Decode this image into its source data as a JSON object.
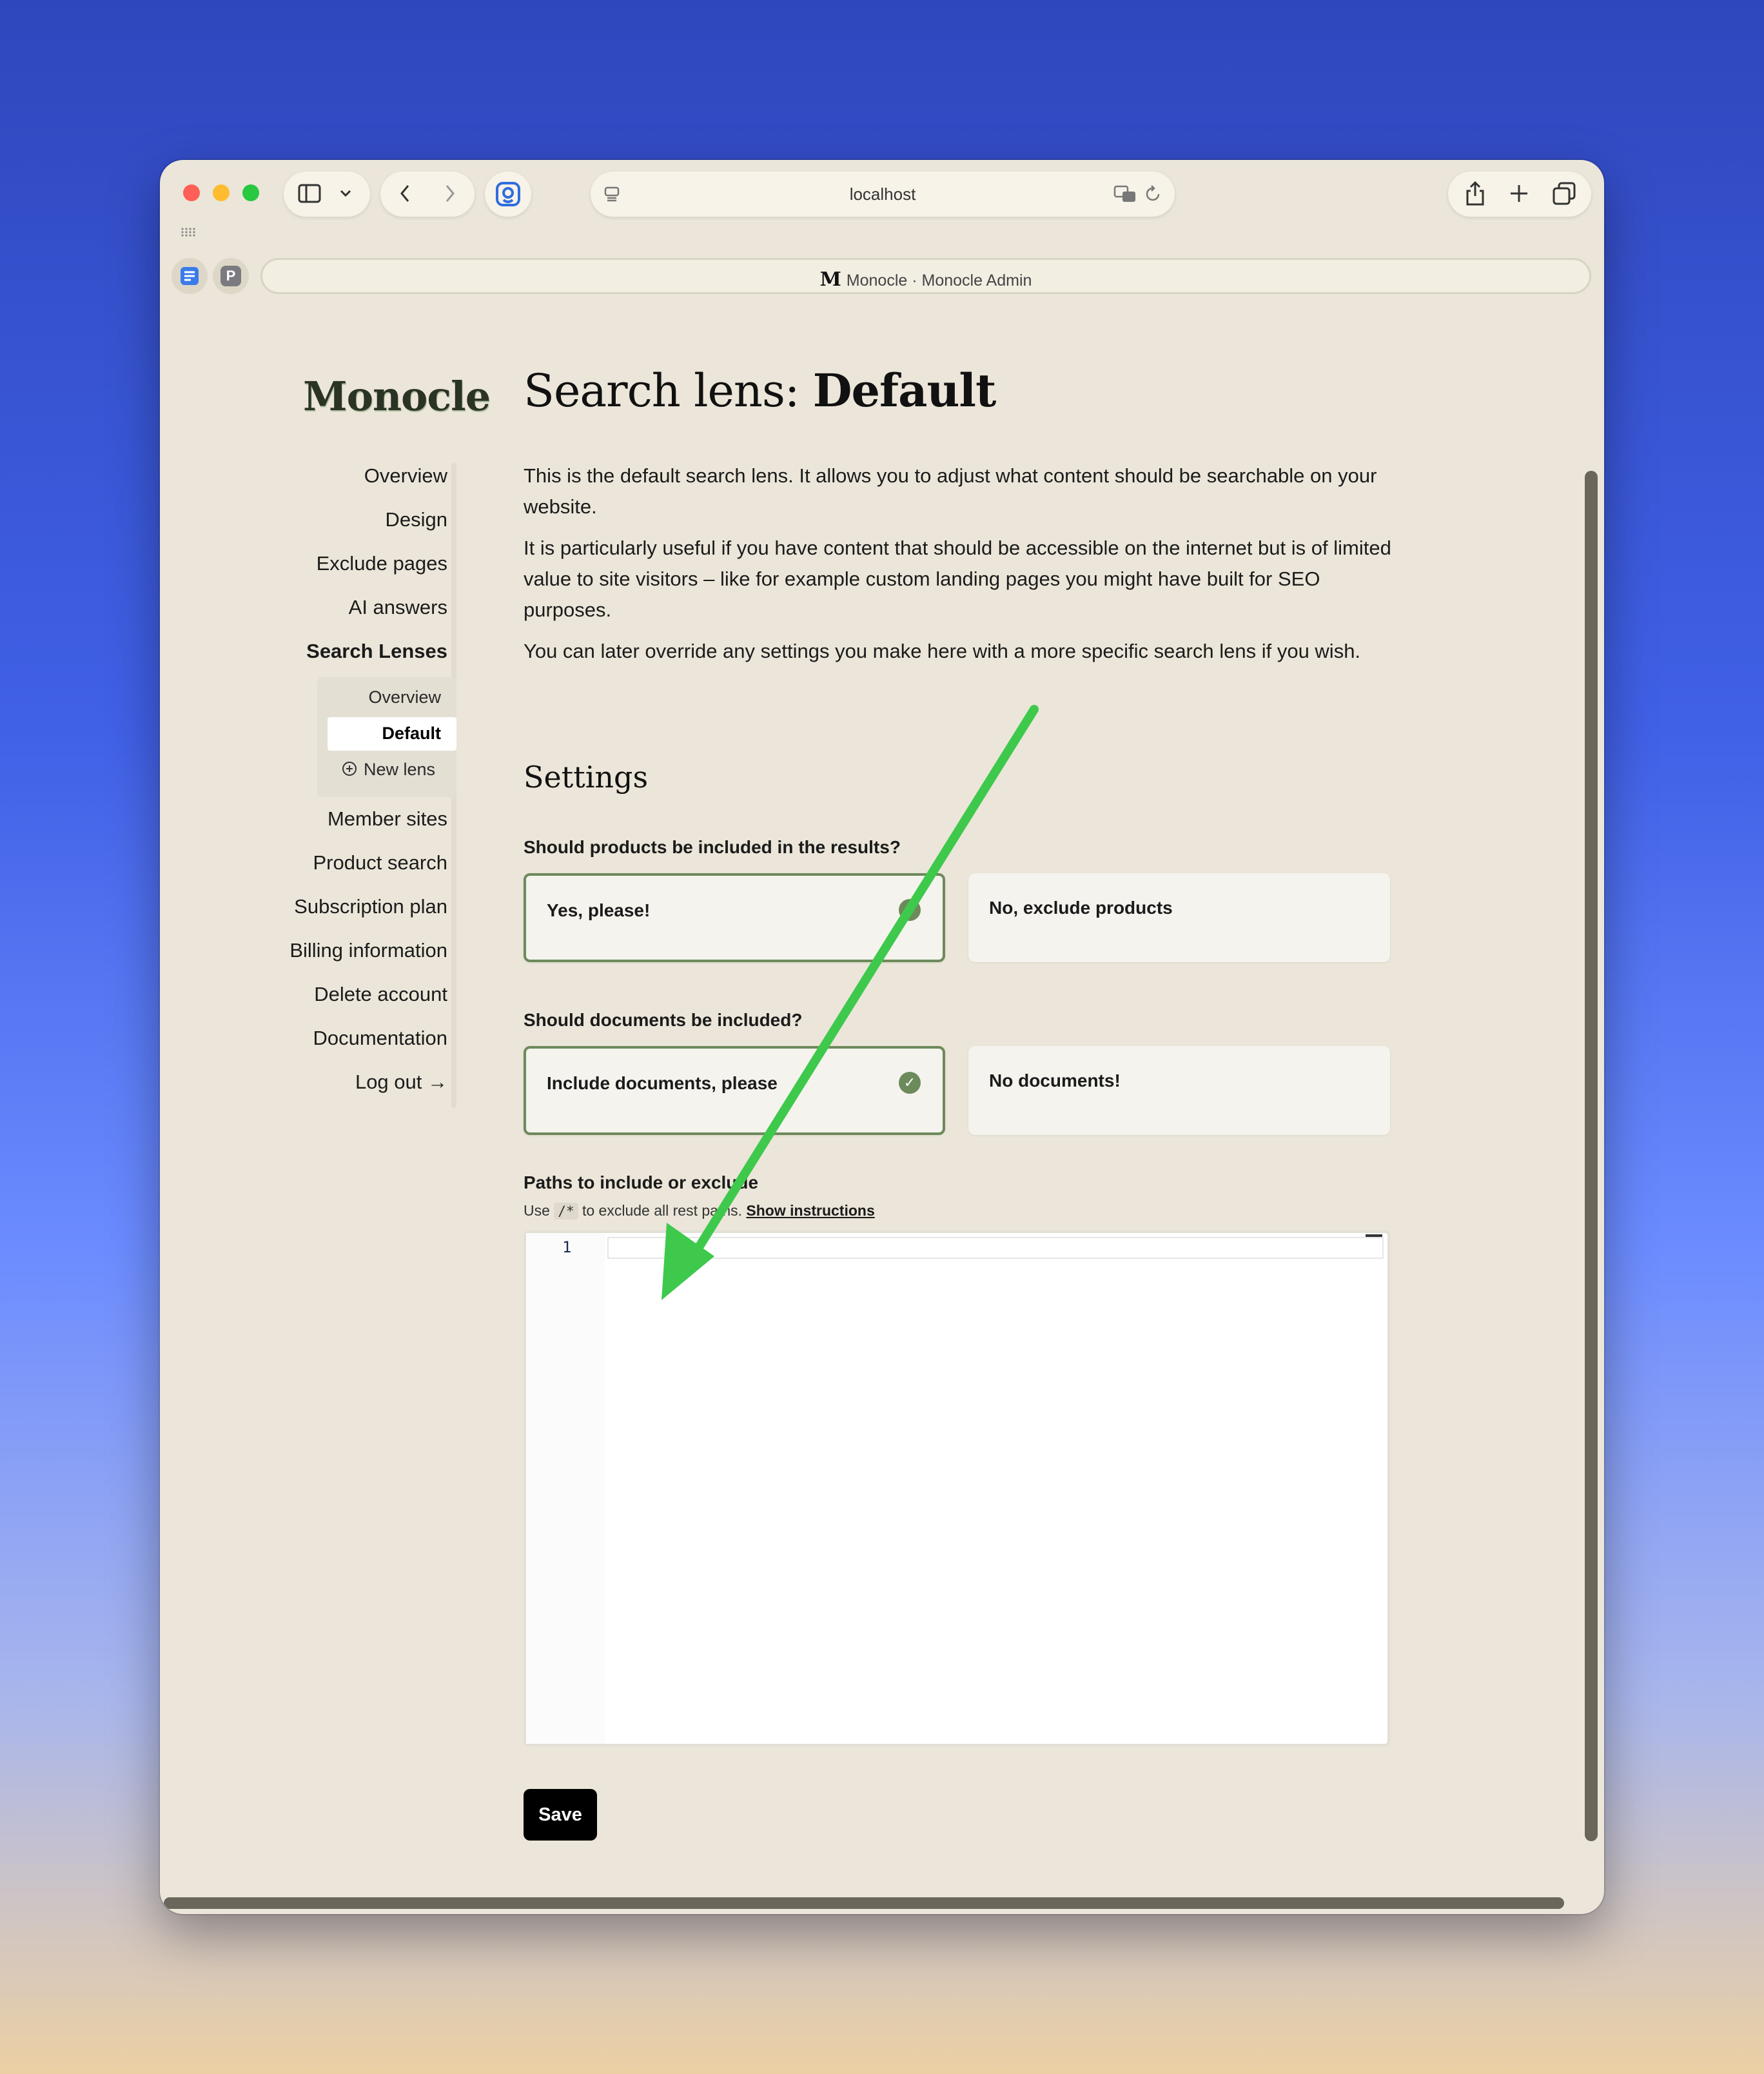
{
  "browser": {
    "url": "localhost",
    "tab_title": "Monocle · Monocle Admin",
    "tab_favicon": "M",
    "extension_badge": "P",
    "icons": [
      "sidebar-toggle-icon",
      "chevron-down-icon",
      "back-icon",
      "forward-icon",
      "extension-icon",
      "page-settings-icon",
      "translate-icon",
      "reload-icon",
      "share-icon",
      "new-tab-icon",
      "tab-overview-icon",
      "grid-icon",
      "reader-icon"
    ]
  },
  "sidebar": {
    "logo": "Monocle",
    "items": [
      {
        "label": "Overview"
      },
      {
        "label": "Design"
      },
      {
        "label": "Exclude pages"
      },
      {
        "label": "AI answers"
      },
      {
        "label": "Search Lenses"
      },
      {
        "label": "Member sites"
      },
      {
        "label": "Product search"
      },
      {
        "label": "Subscription plan"
      },
      {
        "label": "Billing information"
      },
      {
        "label": "Delete account"
      },
      {
        "label": "Documentation"
      },
      {
        "label": "Log out →"
      }
    ],
    "sub_items": [
      {
        "label": "Overview"
      },
      {
        "label": "Default"
      },
      {
        "label": "New lens"
      }
    ]
  },
  "main": {
    "title_prefix": "Search lens: ",
    "title_name": "Default",
    "paragraphs": [
      "This is the default search lens. It allows you to adjust what content should be searchable on your website.",
      "It is particularly useful if you have content that should be accessible on the internet but is of limited value to site visitors – like for example custom landing pages you might have built for SEO purposes.",
      "You can later override any settings you make here with a more specific search lens if you wish."
    ],
    "settings_heading": "Settings",
    "products": {
      "question": "Should products be included in the results?",
      "options": [
        "Yes, please!",
        "No, exclude products"
      ],
      "selected": "Yes, please!"
    },
    "documents": {
      "question": "Should documents be included?",
      "options": [
        "Include documents, please",
        "No documents!"
      ],
      "selected": "Include documents, please"
    },
    "paths": {
      "label": "Paths to include or exclude",
      "hint_prefix": "Use",
      "hint_code": "/*",
      "hint_suffix": "to exclude all rest paths.",
      "hint_link": "Show instructions",
      "line_number": "1",
      "value": ""
    },
    "save_label": "Save"
  },
  "colors": {
    "page_bg": "#ebe6d9",
    "accent_green": "#6d8a5b",
    "annotation_arrow": "#3ec94c"
  }
}
